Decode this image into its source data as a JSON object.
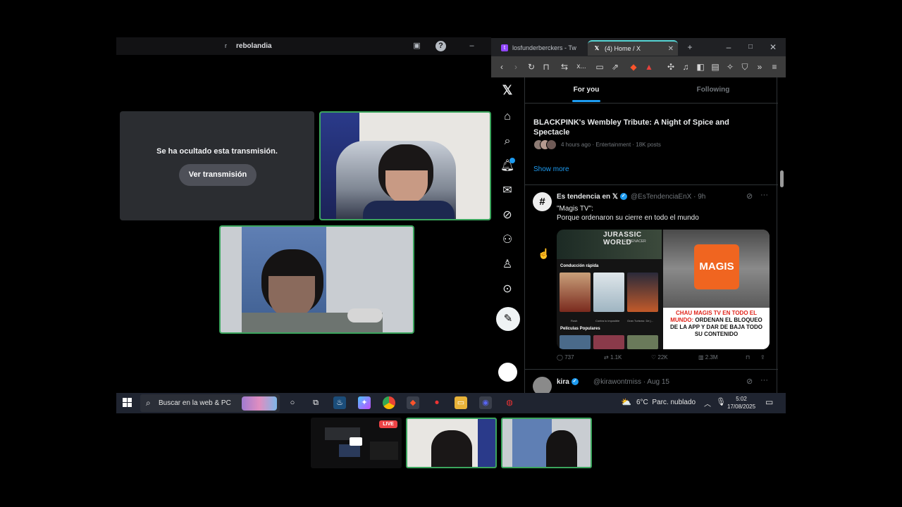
{
  "call": {
    "server_name": "rebolandia",
    "server_prefix": "r",
    "hidden_message": "Se ha ocultado esta transmisión.",
    "view_stream_label": "Ver transmisión"
  },
  "browser": {
    "tabs": [
      {
        "title": "losfunderberckers - Tw",
        "icon": "twitch-icon"
      },
      {
        "title": "(4) Home / X",
        "icon": "x-logo-icon"
      }
    ],
    "new_tab": "+",
    "window_controls": [
      "minimize",
      "maximize",
      "close"
    ],
    "address_abbrev": "x..."
  },
  "x": {
    "feed_tabs": [
      "For you",
      "Following"
    ],
    "trend": {
      "title": "BLACKPINK's Wembley Tribute: A Night of Spice and Spectacle",
      "meta": "4 hours ago · Entertainment · 18K posts"
    },
    "show_more": "Show more",
    "post": {
      "name": "Es tendencia en 𝕏",
      "handle": "@EsTendenciaEnX · 9h",
      "text_line1": "\"Magis TV\":",
      "text_line2": "Porque ordenaron su cierre en todo el mundo",
      "media_left": {
        "banner_title": "JURASSIC WORLD",
        "banner_sub": "EL RENACER",
        "row1": "Conducción rápida",
        "row2": "Películas Populares",
        "captions": [
          "Rush",
          "Contra lo imposible",
          "Gran Turismo: De j..."
        ]
      },
      "media_right": {
        "logo": "MAGIS",
        "headline_red": "CHAU MAGIS TV EN TODO EL MUNDO:",
        "headline_black": "ORDENAN EL BLOQUEO DE LA APP Y DAR DE BAJA TODO SU CONTENIDO"
      },
      "stats": {
        "replies": "737",
        "reposts": "1.1K",
        "likes": "22K",
        "views": "2.3M"
      }
    },
    "next_post": {
      "name": "kira",
      "handle": "@kirawontmiss · Aug 15"
    }
  },
  "taskbar": {
    "search_placeholder": "Buscar en la web & PC",
    "weather_temp": "6°C",
    "weather_desc": "Parc. nublado",
    "time": "5:02",
    "date": "17/08/2025"
  },
  "thumbnails": {
    "live_badge": "LIVE"
  },
  "colors": {
    "x_blue": "#1d9bf0",
    "speaking_green": "#3ba55d",
    "live_red": "#ed4245"
  }
}
